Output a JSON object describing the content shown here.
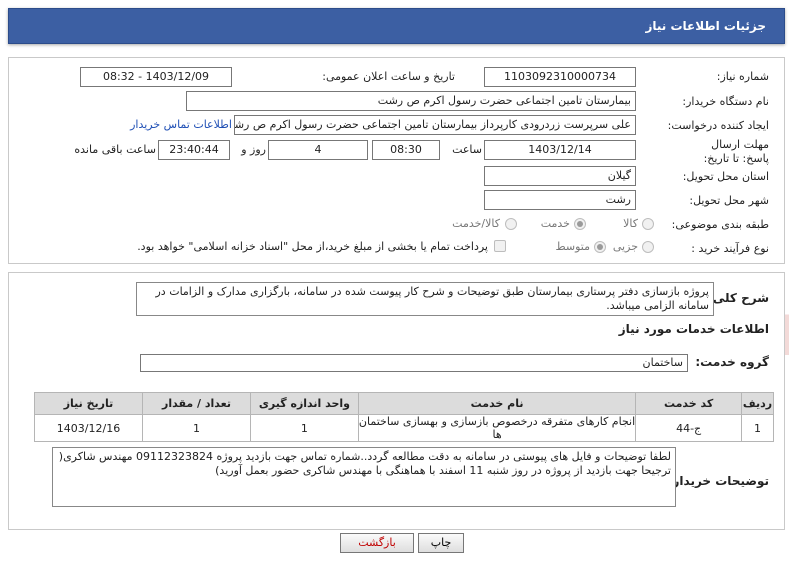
{
  "header": {
    "title": "جزئیات اطلاعات نیاز"
  },
  "need": {
    "need_number_label": "شماره نیاز:",
    "need_number": "1103092310000734",
    "announce_label": "تاریخ و ساعت اعلان عمومی:",
    "announce_value": "1403/12/09 - 08:32",
    "buyer_label": "نام دستگاه خریدار:",
    "buyer_value": "بیمارستان  تامین اجتماعی حضرت رسول اکرم ص رشت",
    "creator_label": "ایجاد کننده درخواست:",
    "creator_value": "علی سرپرست زردرودی کارپرداز بیمارستان  تامین اجتماعی حضرت رسول اکرم ص رشت",
    "contact_link": "اطلاعات تماس خریدار",
    "deadline_label": "مهلت ارسال پاسخ: تا تاریخ:",
    "deadline_date": "1403/12/14",
    "time_label": "ساعت",
    "deadline_time": "08:30",
    "days_value": "4",
    "days_label": "روز و",
    "remaining_time": "23:40:44",
    "remaining_label": "ساعت باقی مانده",
    "province_label": "استان محل تحویل:",
    "province_value": "گیلان",
    "city_label": "شهر محل تحویل:",
    "city_value": "رشت",
    "category_label": "طبقه بندی موضوعی:",
    "category_options": [
      "کالا",
      "خدمت",
      "کالا/خدمت"
    ],
    "category_selected": "خدمت",
    "process_label": "نوع فرآیند خرید :",
    "process_options": [
      "جزیی",
      "متوسط"
    ],
    "process_selected": "متوسط",
    "payment_note": "پرداخت تمام یا بخشی از مبلغ خرید،از محل \"اسناد خزانه اسلامی\" خواهد بود."
  },
  "description": {
    "label": "شرح کلی نیاز:",
    "text": "پروژه بازسازی دفتر پرستاری بیمارستان طبق توضیحات و شرح کار پیوست شده در سامانه، بارگزاری مدارک و الزامات در سامانه الزامی میباشد."
  },
  "services": {
    "section_title": "اطلاعات خدمات مورد نیاز",
    "group_label": "گروه خدمت:",
    "group_value": "ساختمان",
    "table": {
      "headers": [
        "ردیف",
        "کد خدمت",
        "نام خدمت",
        "واحد اندازه گیری",
        "تعداد / مقدار",
        "تاریخ نیاز"
      ],
      "rows": [
        [
          "1",
          "ج-44",
          "انجام کارهای متفرقه درخصوص بازسازی و بهسازی ساختمان ها",
          "1",
          "1",
          "1403/12/16"
        ]
      ]
    }
  },
  "buyer_notes": {
    "label": "توضیحات خریدار:",
    "text": "لطفا توضیحات و فایل های پیوستی در سامانه به دقت مطالعه گردد..شماره تماس جهت بازدید پروژه 09112323824 مهندس شاکری( ترجیحا جهت بازدید از پروژه در روز شنبه 11 اسفند با هماهنگی با مهندس شاکری حضور بعمل آورید)"
  },
  "actions": {
    "print_label": "چاپ",
    "back_label": "بازگشت"
  },
  "watermark": {
    "text": "AriaTender.neT"
  },
  "colors": {
    "header_bg": "#3c5fa3",
    "link": "#1f4fb5",
    "back_button_text": "#c00000",
    "watermark": "#c0392b"
  }
}
